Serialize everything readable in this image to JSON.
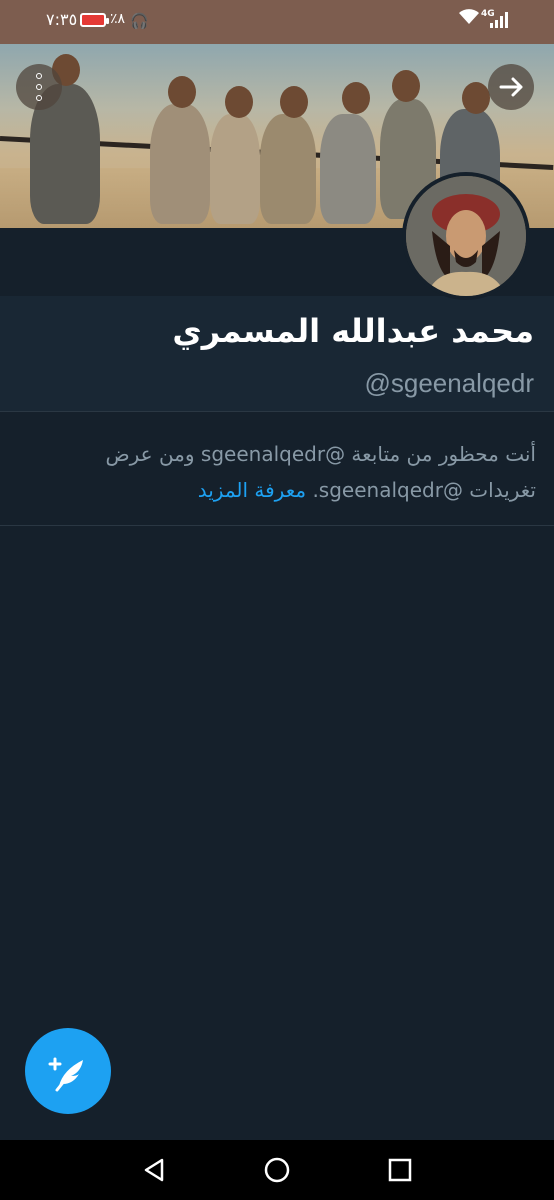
{
  "status_bar": {
    "time": "٧:٣٥",
    "battery_percent": "٪٨",
    "network": "4G"
  },
  "profile": {
    "display_name": "محمد عبدالله المسمري",
    "handle": "@sgeenalqedr"
  },
  "blocked_notice": {
    "text_part1": "أنت محظور من متابعة @sgeenalqedr ومن عرض تغريدات @sgeenalqedr.",
    "learn_more": "معرفة المزيد"
  },
  "icons": {
    "menu": "more-vertical-icon",
    "back": "arrow-right-icon",
    "compose": "compose-tweet-icon",
    "nav_back": "triangle-back-icon",
    "nav_home": "circle-home-icon",
    "nav_recent": "square-recent-icon"
  },
  "colors": {
    "background": "#15202b",
    "accent": "#1da1f2",
    "status_bar": "#7d5d4f",
    "secondary_text": "#8899a6"
  }
}
